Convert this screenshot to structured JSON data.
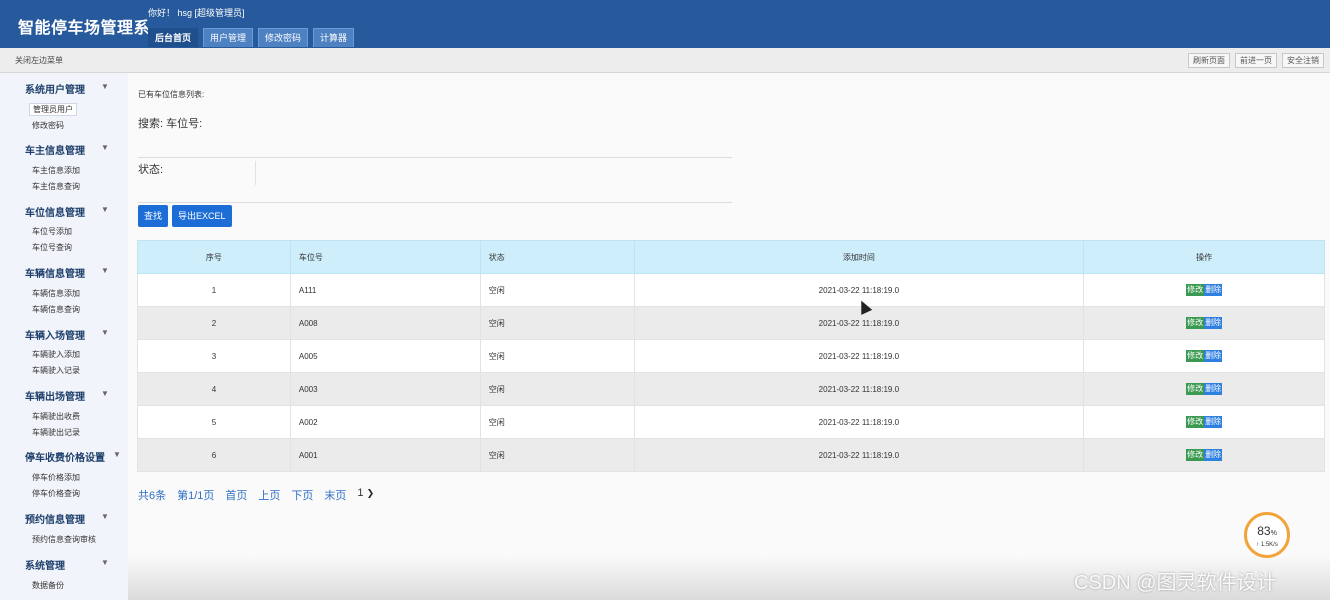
{
  "app": {
    "title": "智能停车场管理系",
    "greeting": "你好！ hsg [超级管理员]"
  },
  "tabs": [
    {
      "label": "后台首页"
    },
    {
      "label": "用户管理"
    },
    {
      "label": "修改密码"
    },
    {
      "label": "计算器"
    }
  ],
  "subbar": {
    "close_menu": "关闭左边菜单",
    "refresh": "刷新页面",
    "forward": "前进一页",
    "logout": "安全注销"
  },
  "sidebar": {
    "groups": [
      {
        "label": "系统用户管理",
        "items": [
          "管理员用户",
          "修改密码"
        ]
      },
      {
        "label": "车主信息管理",
        "items": [
          "车主信息添加",
          "车主信息查询"
        ]
      },
      {
        "label": "车位信息管理",
        "items": [
          "车位号添加",
          "车位号查询"
        ]
      },
      {
        "label": "车辆信息管理",
        "items": [
          "车辆信息添加",
          "车辆信息查询"
        ]
      },
      {
        "label": "车辆入场管理",
        "items": [
          "车辆驶入添加",
          "车辆驶入记录"
        ]
      },
      {
        "label": "车辆出场管理",
        "items": [
          "车辆驶出收费",
          "车辆驶出记录"
        ]
      },
      {
        "label": "停车收费价格设置",
        "items": [
          "停车价格添加",
          "停车价格查询"
        ]
      },
      {
        "label": "预约信息管理",
        "items": [
          "预约信息查询审核"
        ]
      },
      {
        "label": "系统管理",
        "items": [
          "数据备份"
        ]
      }
    ],
    "arrow": "▼"
  },
  "main": {
    "list_title": "已有车位信息列表:",
    "search_label": "搜索: 车位号:",
    "status_label": "状态:",
    "search_button": "查找",
    "export_button": "导出EXCEL"
  },
  "table": {
    "headers": [
      "序号",
      "车位号",
      "状态",
      "添加时间",
      "操作"
    ],
    "rows": [
      {
        "no": "1",
        "spot": "A111",
        "status": "空闲",
        "time": "2021-03-22 11:18:19.0"
      },
      {
        "no": "2",
        "spot": "A008",
        "status": "空闲",
        "time": "2021-03-22 11:18:19.0"
      },
      {
        "no": "3",
        "spot": "A005",
        "status": "空闲",
        "time": "2021-03-22 11:18:19.0"
      },
      {
        "no": "4",
        "spot": "A003",
        "status": "空闲",
        "time": "2021-03-22 11:18:19.0"
      },
      {
        "no": "5",
        "spot": "A002",
        "status": "空闲",
        "time": "2021-03-22 11:18:19.0"
      },
      {
        "no": "6",
        "spot": "A001",
        "status": "空闲",
        "time": "2021-03-22 11:18:19.0"
      }
    ],
    "edit_label": "修改",
    "delete_label": "删除"
  },
  "pager": {
    "total": "共6条",
    "page_info": "第1/1页",
    "first": "首页",
    "prev": "上页",
    "next": "下页",
    "last": "末页",
    "current": "1"
  },
  "widget": {
    "percent": "83",
    "percent_unit": "%",
    "rate": "↑ 1.5K/s"
  },
  "watermark": "CSDN @图灵软件设计",
  "colors": {
    "header": "#275a9c",
    "table_header": "#cdeefa",
    "primary_button": "#1c6ed6",
    "edit_button": "#3b9a52",
    "delete_button": "#2e7fe0",
    "pager_link": "#2f6fc4",
    "widget_ring": "#f2a33a"
  }
}
